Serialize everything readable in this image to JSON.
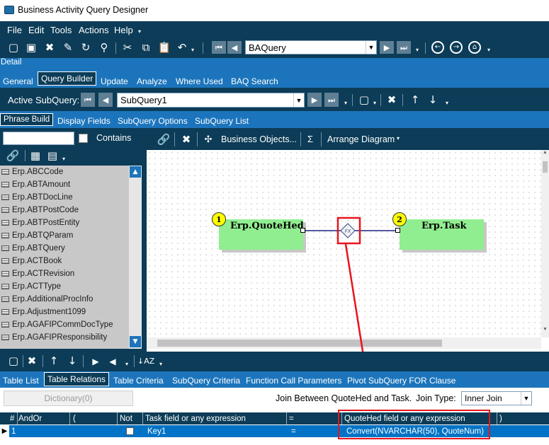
{
  "window": {
    "title": "Business Activity Query Designer"
  },
  "menu": [
    "File",
    "Edit",
    "Tools",
    "Actions",
    "Help"
  ],
  "toolbar": {
    "query_select_value": "BAQuery"
  },
  "detail_label": "Detail",
  "main_tabs": [
    "General",
    "Query Builder",
    "Update",
    "Analyze",
    "Where Used",
    "BAQ Search"
  ],
  "active_subquery": {
    "label": "Active SubQuery:",
    "value": "SubQuery1"
  },
  "sub_tabs": [
    "Phrase Build",
    "Display Fields",
    "SubQuery Options",
    "SubQuery List"
  ],
  "search": {
    "contains_label": "Contains",
    "value": ""
  },
  "table_list": [
    "Erp.ABCCode",
    "Erp.ABTAmount",
    "Erp.ABTDocLine",
    "Erp.ABTPostCode",
    "Erp.ABTPostEntity",
    "Erp.ABTQParam",
    "Erp.ABTQuery",
    "Erp.ACTBook",
    "Erp.ACTRevision",
    "Erp.ACTType",
    "Erp.AdditionalProcInfo",
    "Erp.Adjustment1099",
    "Erp.AGAFIPCommDocType",
    "Erp.AGAFIPResponsibility"
  ],
  "diagram_toolbar": {
    "business_objects": "Business Objects...",
    "sigma": "Σ",
    "arrange": "Arrange Diagram"
  },
  "diagram": {
    "nodes": [
      {
        "num": "1",
        "label": "Erp.QuoteHed"
      },
      {
        "num": "2",
        "label": "Erp.Task"
      }
    ],
    "join_label": "FX"
  },
  "bottom_tabs": [
    "Table List",
    "Table Relations",
    "Table Criteria",
    "SubQuery Criteria",
    "Function Call Parameters",
    "Pivot SubQuery FOR Clause"
  ],
  "relations": {
    "dictionary_button": "Dictionary(0)",
    "join_between": "Join Between QuoteHed and Task.",
    "join_type_label": "Join Type:",
    "join_type_value": "Inner Join",
    "columns": [
      "#",
      "AndOr",
      "(",
      "Not",
      "Task field or any expression",
      "=",
      "QuoteHed field or any expression",
      ")"
    ],
    "rows": [
      {
        "num": "1",
        "andor": "",
        "open": "",
        "not": false,
        "task_field": "Key1",
        "op": "=",
        "quotehed_field": "Convert(NVARCHAR(50), QuoteNum)",
        "close": ""
      }
    ]
  },
  "colors": {
    "dark": "#0c3c57",
    "selected_row": "#0073c6",
    "node": "#90ee90",
    "highlight": "#e8141c"
  }
}
